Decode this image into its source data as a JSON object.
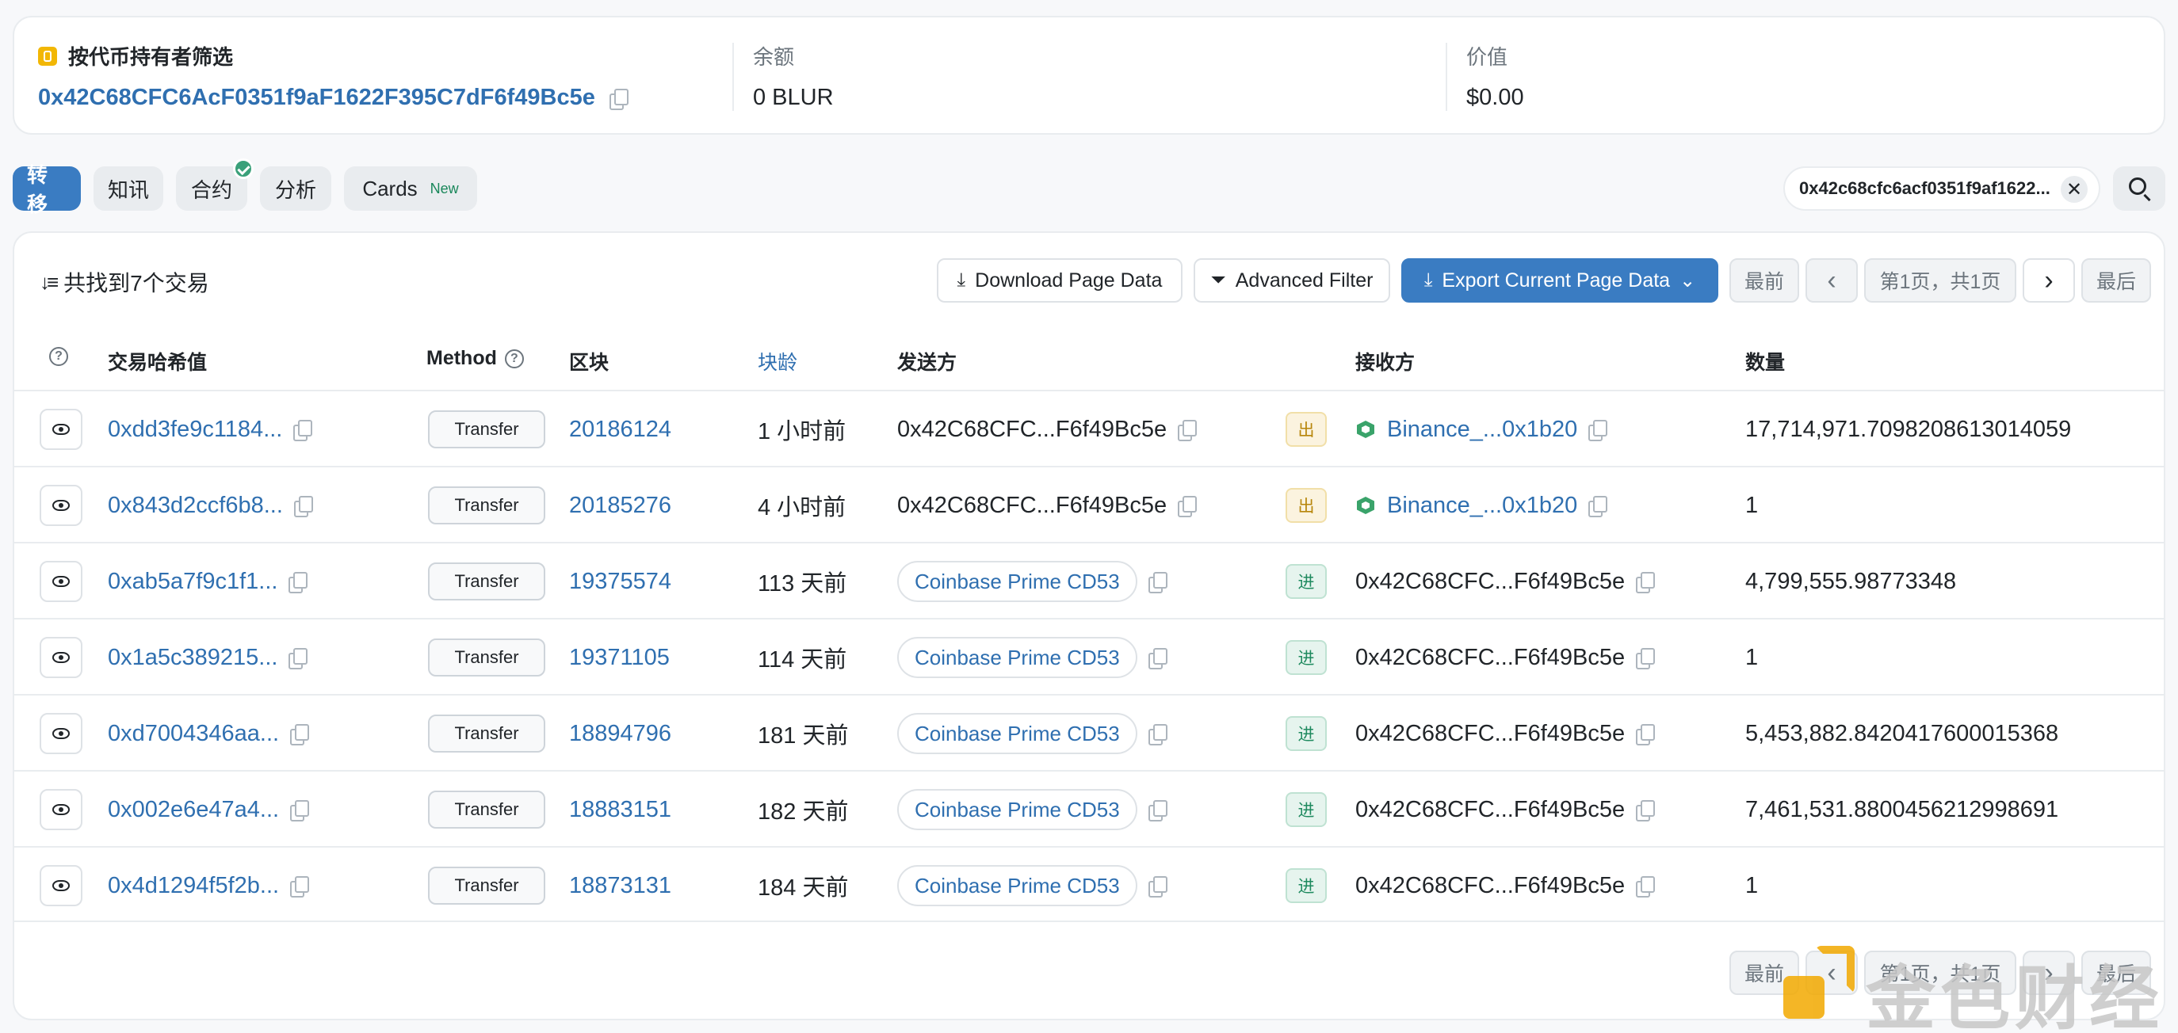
{
  "summary": {
    "title": "按代币持有者筛选",
    "address": "0x42C68CFC6AcF0351f9aF1622F395C7dF6f49Bc5e",
    "balance_label": "余额",
    "balance_value": "0 BLUR",
    "value_label": "价值",
    "value_value": "$0.00"
  },
  "tabs": [
    {
      "label": "转移",
      "active": true
    },
    {
      "label": "知讯"
    },
    {
      "label": "合约",
      "verified": true
    },
    {
      "label": "分析"
    },
    {
      "label": "Cards",
      "badge": "New"
    }
  ],
  "filter": {
    "address": "0x42c68cfc6acf0351f9af1622...",
    "close": "✕"
  },
  "toolbar": {
    "found_text": "共找到7个交易",
    "download": "Download Page Data",
    "advanced_filter": "Advanced Filter",
    "export": "Export Current Page Data"
  },
  "pager": {
    "first": "最前",
    "prev": "‹",
    "page_info": "第1页，共1页",
    "next": "›",
    "last": "最后"
  },
  "columns": {
    "hash": "交易哈希值",
    "method": "Method",
    "block": "区块",
    "age": "块龄",
    "from": "发送方",
    "to": "接收方",
    "quantity": "数量"
  },
  "rows": [
    {
      "hash": "0xdd3fe9c1184...",
      "method": "Transfer",
      "block": "20186124",
      "age": "1 小时前",
      "from": "0x42C68CFC...F6f49Bc5e",
      "from_pill": false,
      "dir": "出",
      "dir_type": "out",
      "to": "Binance_...0x1b20",
      "to_link": true,
      "quantity": "17,714,971.7098208613014059"
    },
    {
      "hash": "0x843d2ccf6b8...",
      "method": "Transfer",
      "block": "20185276",
      "age": "4 小时前",
      "from": "0x42C68CFC...F6f49Bc5e",
      "from_pill": false,
      "dir": "出",
      "dir_type": "out",
      "to": "Binance_...0x1b20",
      "to_link": true,
      "quantity": "1"
    },
    {
      "hash": "0xab5a7f9c1f1...",
      "method": "Transfer",
      "block": "19375574",
      "age": "113 天前",
      "from": "Coinbase Prime CD53",
      "from_pill": true,
      "dir": "进",
      "dir_type": "in",
      "to": "0x42C68CFC...F6f49Bc5e",
      "to_link": false,
      "quantity": "4,799,555.98773348"
    },
    {
      "hash": "0x1a5c389215...",
      "method": "Transfer",
      "block": "19371105",
      "age": "114 天前",
      "from": "Coinbase Prime CD53",
      "from_pill": true,
      "dir": "进",
      "dir_type": "in",
      "to": "0x42C68CFC...F6f49Bc5e",
      "to_link": false,
      "quantity": "1"
    },
    {
      "hash": "0xd7004346aa...",
      "method": "Transfer",
      "block": "18894796",
      "age": "181 天前",
      "from": "Coinbase Prime CD53",
      "from_pill": true,
      "dir": "进",
      "dir_type": "in",
      "to": "0x42C68CFC...F6f49Bc5e",
      "to_link": false,
      "quantity": "5,453,882.8420417600015368"
    },
    {
      "hash": "0x002e6e47a4...",
      "method": "Transfer",
      "block": "18883151",
      "age": "182 天前",
      "from": "Coinbase Prime CD53",
      "from_pill": true,
      "dir": "进",
      "dir_type": "in",
      "to": "0x42C68CFC...F6f49Bc5e",
      "to_link": false,
      "quantity": "7,461,531.8800456212998691"
    },
    {
      "hash": "0x4d1294f5f2b...",
      "method": "Transfer",
      "block": "18873131",
      "age": "184 天前",
      "from": "Coinbase Prime CD53",
      "from_pill": true,
      "dir": "进",
      "dir_type": "in",
      "to": "0x42C68CFC...F6f49Bc5e",
      "to_link": false,
      "quantity": "1"
    }
  ],
  "watermark": {
    "text": "金色财经"
  },
  "colors": {
    "accent": "#3a7cc2",
    "link": "#2f6fb0",
    "out": "#b7860b",
    "in": "#1f8a5f"
  }
}
